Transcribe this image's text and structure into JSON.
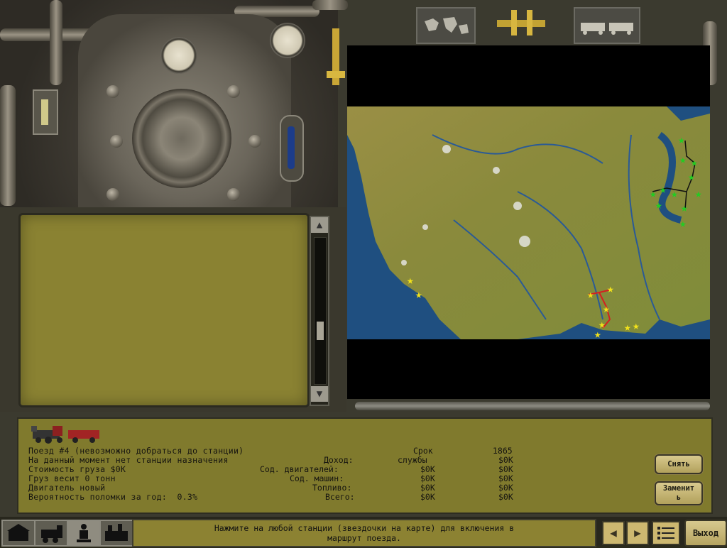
{
  "info": {
    "train_title": "Поезд #4 (невозможно добраться до станции)",
    "line2": "На данный момент нет станции назначения",
    "line3": "Стоимость груза $0K",
    "line4": "Груз весит 0 тонн",
    "line5": "Двигатель новый",
    "line6": "Вероятность поломки за год:  0.3%",
    "labels": {
      "income": "Доход:",
      "engine_cost": "Сод. двигателей:",
      "car_cost": "Сод. машин:",
      "fuel": "Топливо:",
      "total": "Всего:"
    },
    "service_header": "Срок",
    "service_header2": "службы",
    "year": "1865",
    "col1": [
      "",
      "$0K",
      "$0K",
      "$0K",
      "$0K"
    ],
    "col2": [
      "$0K",
      "$0K",
      "$0K",
      "$0K",
      "$0K"
    ]
  },
  "buttons": {
    "remove": "Снять",
    "replace_1": "Заменит",
    "replace_2": "ь",
    "exit": "Выход"
  },
  "status": {
    "line1": "Нажмите на любой станции (звездочки на карте) для включения в",
    "line2": "маршрут поезда."
  },
  "scrollbar": {
    "up": "▲",
    "down": "▼"
  },
  "nav": {
    "prev": "◀",
    "next": "▶"
  },
  "map": {
    "land_color": "#8b8a3a",
    "water_color": "#1f4f80",
    "green_stations_color": "#22cc22",
    "yellow_stations_color": "#f2e21a",
    "route_color": "#d42020"
  }
}
